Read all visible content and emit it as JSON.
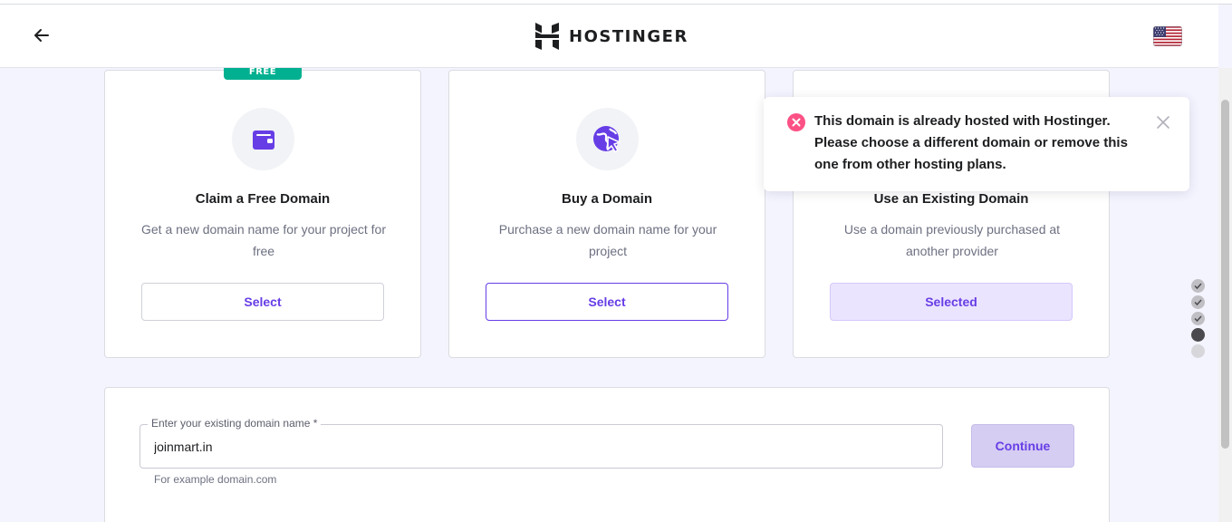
{
  "header": {
    "logo_text": "HOSTINGER",
    "back_icon": "arrow-left-icon",
    "language_icon": "us-flag-icon"
  },
  "cards": [
    {
      "badge": "FREE",
      "icon": "wallet-icon",
      "title": "Claim a Free Domain",
      "description": "Get a new domain name for your project for free",
      "button_label": "Select"
    },
    {
      "icon": "globe-cursor-icon",
      "title": "Buy a Domain",
      "description": "Purchase a new domain name for your project",
      "button_label": "Select"
    },
    {
      "title": "Use an Existing Domain",
      "description": "Use a domain previously purchased at another provider",
      "button_label": "Selected"
    }
  ],
  "toast": {
    "icon": "error-circle-icon",
    "message": "This domain is already hosted with Hostinger. Please choose a different domain or remove this one from other hosting plans.",
    "close_icon": "close-icon"
  },
  "domain_form": {
    "label": "Enter your existing domain name *",
    "value": "joinmart.in",
    "hint": "For example domain.com",
    "continue_label": "Continue"
  },
  "progress": {
    "total_steps": 5,
    "completed_steps": 3,
    "current_step": 4
  },
  "colors": {
    "brand": "#673de6",
    "free_badge": "#00b090",
    "error": "#fc5185",
    "page_background": "#f4f4ff"
  }
}
